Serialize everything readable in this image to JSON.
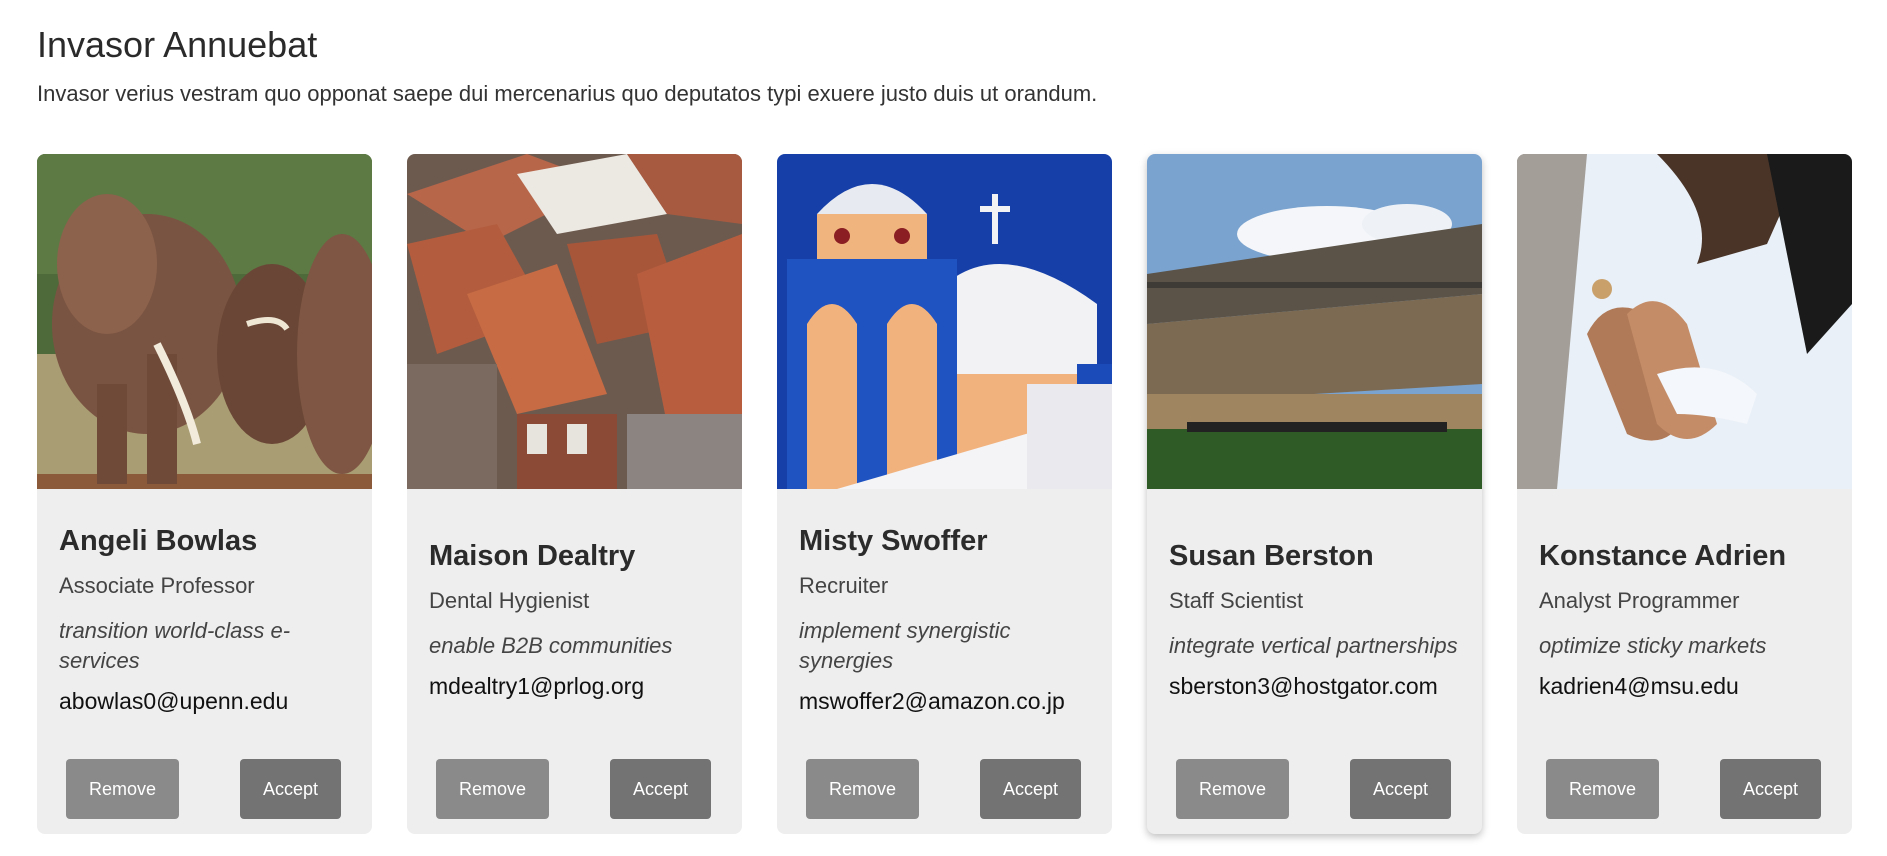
{
  "header": {
    "title": "Invasor Annuebat",
    "subtitle": "Invasor verius vestram quo opponat saepe dui mercenarius quo deputatos typi exuere justo duis ut orandum."
  },
  "cards": [
    {
      "name": "Angeli Bowlas",
      "role": "Associate Professor",
      "tagline": "transition world-class e-services",
      "email": "abowlas0@upenn.edu",
      "image": "elephants-photo",
      "remove_label": "Remove",
      "accept_label": "Accept"
    },
    {
      "name": "Maison Dealtry",
      "role": "Dental Hygienist",
      "tagline": "enable B2B communities",
      "email": "mdealtry1@prlog.org",
      "image": "rooftops-photo",
      "remove_label": "Remove",
      "accept_label": "Accept"
    },
    {
      "name": "Misty Swoffer",
      "role": "Recruiter",
      "tagline": "implement synergistic synergies",
      "email": "mswoffer2@amazon.co.jp",
      "image": "church-dome-photo",
      "remove_label": "Remove",
      "accept_label": "Accept"
    },
    {
      "name": "Susan Berston",
      "role": "Staff Scientist",
      "tagline": "integrate vertical partnerships",
      "email": "sberston3@hostgator.com",
      "image": "stadium-photo",
      "remove_label": "Remove",
      "accept_label": "Accept"
    },
    {
      "name": "Konstance Adrien",
      "role": "Analyst Programmer",
      "tagline": "optimize sticky markets",
      "email": "kadrien4@msu.edu",
      "image": "holding-hands-photo",
      "remove_label": "Remove",
      "accept_label": "Accept"
    }
  ],
  "colors": {
    "card_bg": "#eeeeee",
    "remove_button": "#8a8a8a",
    "accept_button": "#737373"
  }
}
